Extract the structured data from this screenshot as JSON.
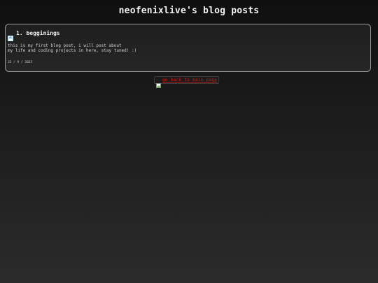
{
  "page": {
    "title": "neofenixlive's blog posts"
  },
  "post": {
    "icon": "house-icon",
    "title": "1. begginings",
    "body": "this is my first blog post, i will post about\nmy life and coding projects in here, stay tuned! :)",
    "date": "25 / 9 / 2025"
  },
  "nav": {
    "back_icon": "broken-image-icon",
    "back_label": "go back to main page"
  },
  "colors": {
    "link": "#d11a1a",
    "card_border": "#9a9a9a"
  }
}
